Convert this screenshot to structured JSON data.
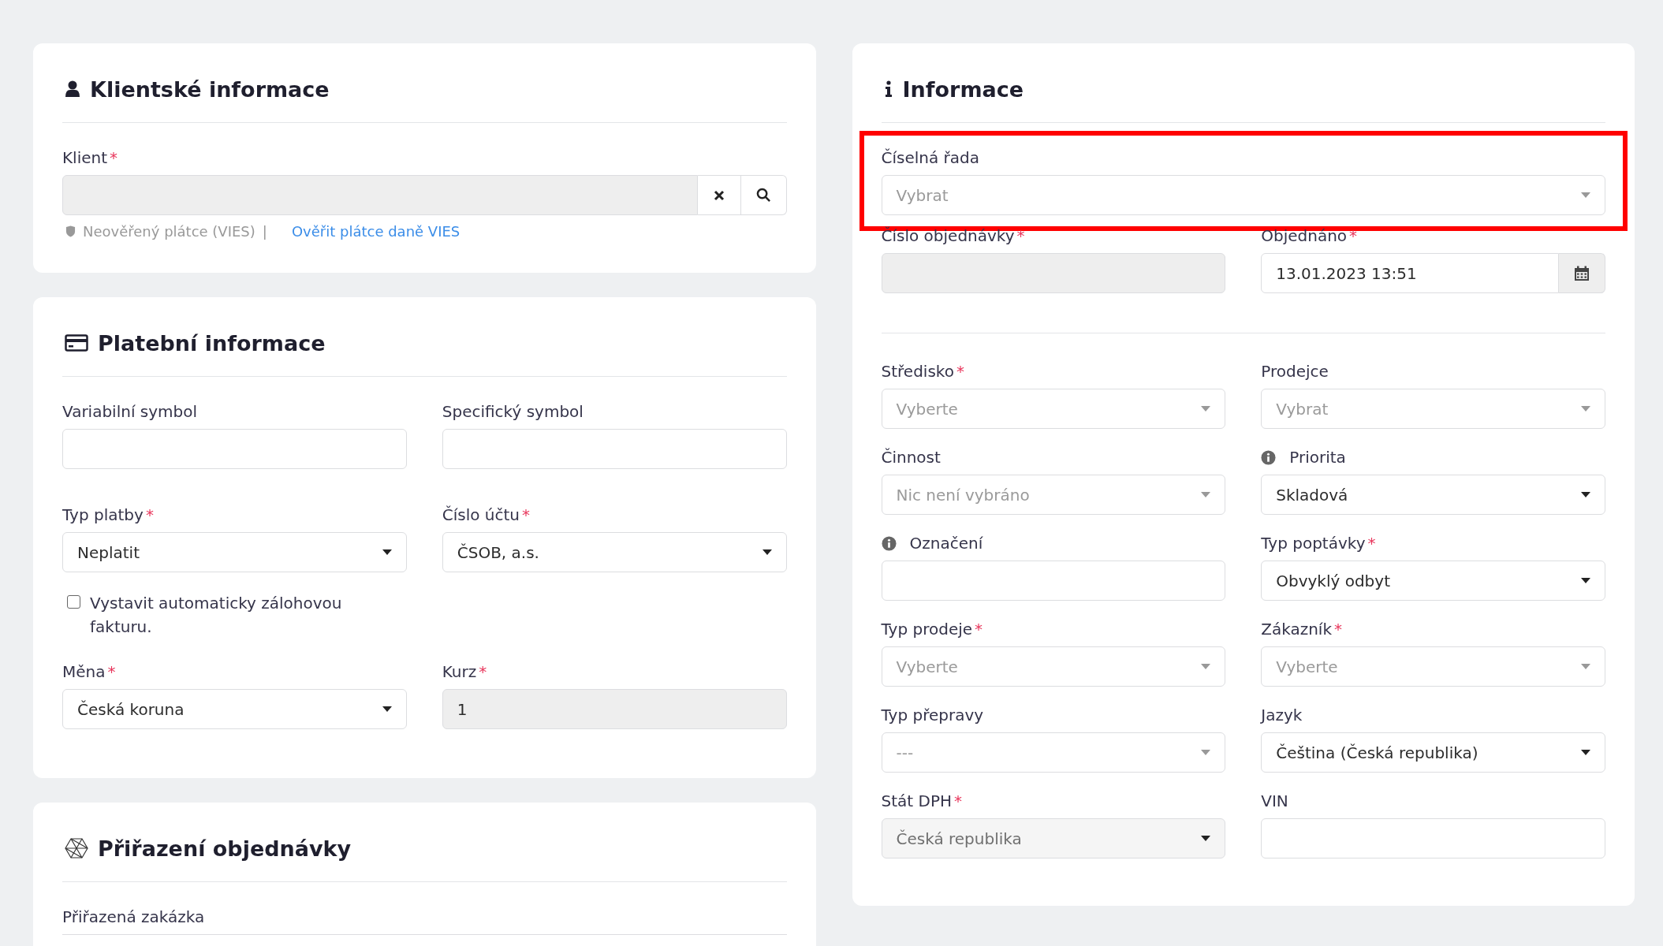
{
  "left_cards": [
    {
      "title": "Klientské informace",
      "fields": [
        {
          "kind": "lookup",
          "label": "Klient",
          "mark": "*",
          "wide": true,
          "disabled": true,
          "status": "Neověřený plátce (VIES)",
          "separator": "|",
          "link": "Ověřit plátce daně VIES"
        }
      ]
    },
    {
      "title": "Platební informace",
      "fields": [
        {
          "kind": "input",
          "label": "Variabilní symbol",
          "disabled": false
        },
        {
          "kind": "input",
          "label": "Specifický symbol",
          "disabled": false
        },
        {
          "kind": "select",
          "label": "Typ platby",
          "mark": "*",
          "value": "Neplatit"
        },
        {
          "kind": "select",
          "label": "Číslo účtu",
          "mark": "*",
          "value": "ČSOB, a.s."
        },
        {
          "kind": "checkbox",
          "text": "Vystavit automaticky zálohovou fakturu.",
          "checked": false
        },
        {
          "kind": "select",
          "label": "Měna",
          "mark": "*",
          "value": "Česká koruna"
        },
        {
          "kind": "input",
          "label": "Kurz",
          "mark": "*",
          "disabled": true,
          "value": "1"
        }
      ]
    },
    {
      "title": "Přiřazení objednávky",
      "fields": [
        {
          "kind": "cut",
          "label": "Přiřazená zakázka",
          "wide": true
        }
      ]
    }
  ],
  "info_card": {
    "title": "Informace",
    "top_fields": [
      {
        "kind": "select",
        "label": "Číselná řada",
        "wide": true,
        "highlighted": true,
        "placeholder": "Vybrat"
      },
      {
        "kind": "input",
        "label": "Číslo objednávky",
        "mark": "*",
        "disabled": true
      },
      {
        "kind": "date",
        "label": "Objednáno",
        "mark": "*",
        "value": "13.01.2023 13:51"
      }
    ],
    "fields": [
      {
        "kind": "select",
        "label": "Středisko",
        "mark": "*",
        "placeholder": "Vyberte"
      },
      {
        "kind": "select",
        "label": "Prodejce",
        "placeholder": "Vybrat"
      },
      {
        "kind": "select",
        "label": "Činnost",
        "placeholder": "Nic není vybráno"
      },
      {
        "kind": "select",
        "label": "Priorita",
        "info": true,
        "value": "Skladová"
      },
      {
        "kind": "input",
        "label": "Označení",
        "info": true,
        "disabled": false
      },
      {
        "kind": "select",
        "label": "Typ poptávky",
        "mark": "*",
        "value": "Obvyklý odbyt"
      },
      {
        "kind": "select",
        "label": "Typ prodeje",
        "mark": "*",
        "placeholder": "Vyberte"
      },
      {
        "kind": "select",
        "label": "Zákazník",
        "mark": "*",
        "placeholder": "Vyberte"
      },
      {
        "kind": "select",
        "label": "Typ přepravy",
        "placeholder": "---"
      },
      {
        "kind": "select",
        "label": "Jazyk",
        "value": "Čeština (Česká republika)"
      },
      {
        "kind": "select",
        "label": "Stát DPH",
        "mark": "*",
        "disabled": true,
        "value": "Česká republika"
      },
      {
        "kind": "input",
        "label": "VIN",
        "disabled": false
      }
    ]
  }
}
